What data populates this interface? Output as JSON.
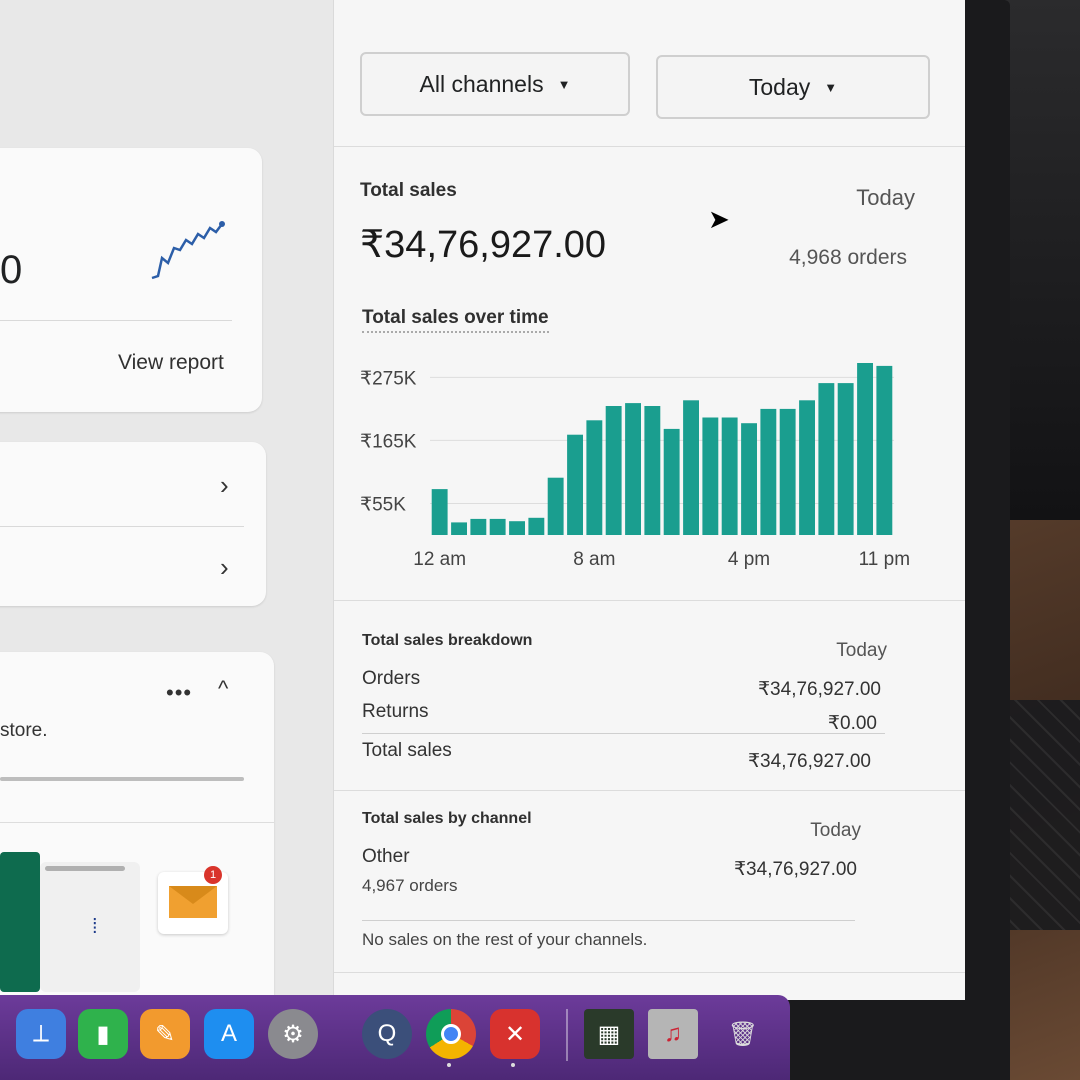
{
  "left": {
    "card1": {
      "big_value": "0",
      "view_report": "View report"
    },
    "card2": {
      "chevron": "›"
    },
    "card3": {
      "menu": "•••",
      "collapse": "^",
      "text": "store."
    }
  },
  "filters": {
    "channel": "All channels",
    "period": "Today"
  },
  "total_sales": {
    "label": "Total sales",
    "period": "Today",
    "amount": "₹34,76,927.00",
    "orders": "4,968 orders"
  },
  "sales_over_time": {
    "label": "Total sales over time"
  },
  "chart_data": {
    "type": "bar",
    "ylabel": "",
    "xlabel": "",
    "y_ticks": [
      "₹275K",
      "₹165K",
      "₹55K"
    ],
    "y_tick_values": [
      275,
      165,
      55
    ],
    "x_tick_labels": [
      "12 am",
      "8 am",
      "4 pm",
      "11 pm"
    ],
    "x_tick_indices": [
      0,
      8,
      16,
      23
    ],
    "ylim": [
      0,
      300
    ],
    "unit": "₹K",
    "color": "#1a9e8f",
    "values": [
      80,
      22,
      28,
      28,
      24,
      30,
      100,
      175,
      200,
      225,
      230,
      225,
      185,
      235,
      205,
      205,
      195,
      220,
      220,
      235,
      265,
      265,
      300,
      295
    ]
  },
  "breakdown": {
    "label": "Total sales breakdown",
    "period": "Today",
    "rows": [
      {
        "label": "Orders",
        "value": "₹34,76,927.00"
      },
      {
        "label": "Returns",
        "value": "₹0.00"
      },
      {
        "label": "Total sales",
        "value": "₹34,76,927.00"
      }
    ]
  },
  "by_channel": {
    "label": "Total sales by channel",
    "period": "Today",
    "channel": "Other",
    "orders": "4,967 orders",
    "value": "₹34,76,927.00",
    "note": "No sales on the rest of your channels."
  },
  "colors": {
    "bar": "#1a9e8f",
    "dock": "#5b2f86"
  },
  "dock": {
    "apps": [
      "keynote-icon",
      "numbers-icon",
      "pages-icon",
      "app-store-icon",
      "system-settings-icon",
      "quicktime-icon",
      "chrome-icon",
      "remote-desktop-icon",
      "photo-thumb-icon",
      "music-thumb-icon",
      "trash-icon"
    ],
    "mail_badge": "1"
  }
}
